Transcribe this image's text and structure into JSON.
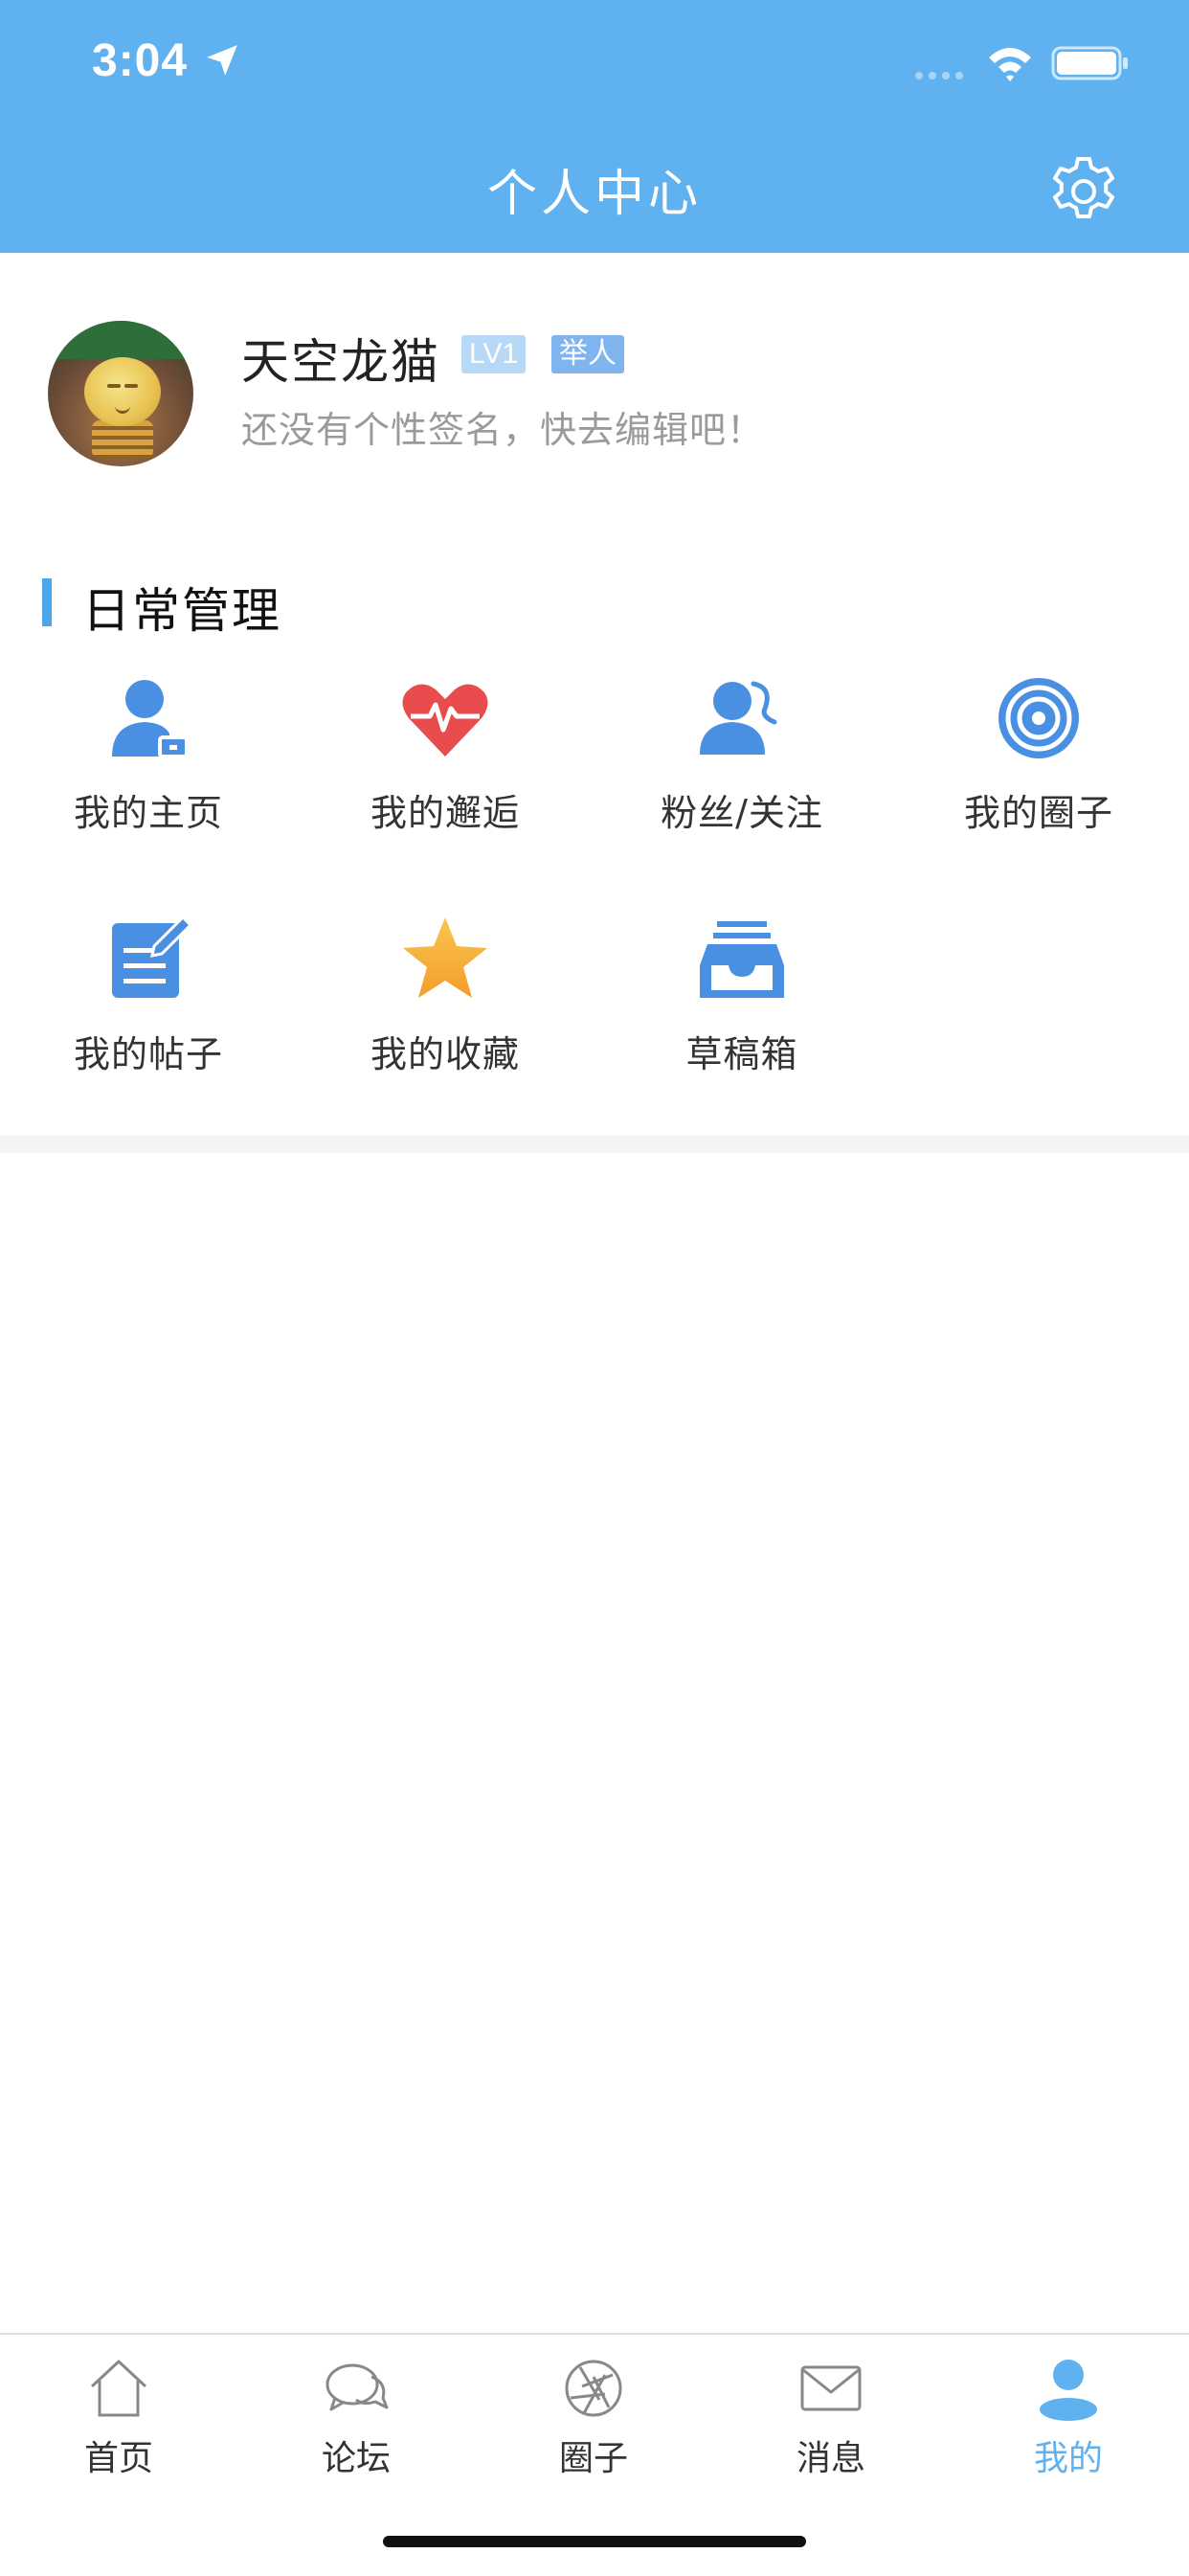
{
  "status_bar": {
    "time": "3:04"
  },
  "header": {
    "title": "个人中心"
  },
  "profile": {
    "username": "天空龙猫",
    "level_badge": "LV1",
    "title_badge": "举人",
    "signature": "还没有个性签名，快去编辑吧！"
  },
  "daily": {
    "section_title": "日常管理",
    "items": [
      {
        "label": "我的主页",
        "icon": "user-home-icon",
        "color": "#4a90e2"
      },
      {
        "label": "我的邂逅",
        "icon": "heartbeat-icon",
        "color": "#e84c4c"
      },
      {
        "label": "粉丝/关注",
        "icon": "followers-icon",
        "color": "#4a90e2"
      },
      {
        "label": "我的圈子",
        "icon": "circle-target-icon",
        "color": "#4a90e2"
      },
      {
        "label": "我的帖子",
        "icon": "edit-post-icon",
        "color": "#4a90e2"
      },
      {
        "label": "我的收藏",
        "icon": "star-icon",
        "color": "#f5a623"
      },
      {
        "label": "草稿箱",
        "icon": "inbox-tray-icon",
        "color": "#4a90e2"
      }
    ]
  },
  "tabbar": {
    "active_color": "#5fb1ef",
    "tabs": [
      {
        "label": "首页",
        "icon": "home-icon"
      },
      {
        "label": "论坛",
        "icon": "chat-bubbles-icon"
      },
      {
        "label": "圈子",
        "icon": "aperture-icon"
      },
      {
        "label": "消息",
        "icon": "mail-icon"
      },
      {
        "label": "我的",
        "icon": "person-icon",
        "active": true
      }
    ]
  }
}
